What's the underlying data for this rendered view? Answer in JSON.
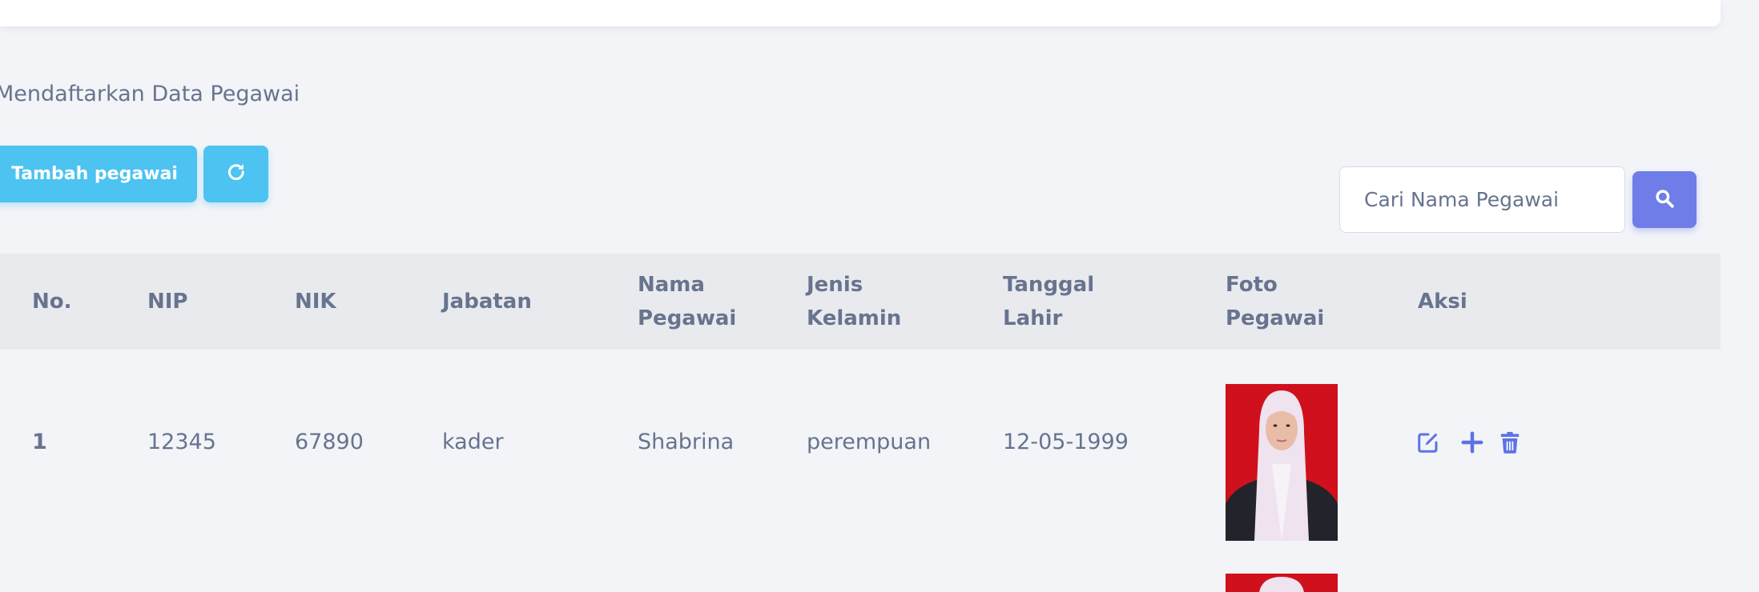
{
  "page": {
    "subtitle": "Mendaftarkan Data Pegawai"
  },
  "toolbar": {
    "add_label": "Tambah pegawai",
    "refresh_icon": "refresh-icon"
  },
  "search": {
    "placeholder": "Cari Nama Pegawai",
    "button_icon": "search-icon"
  },
  "table": {
    "headers": {
      "no": "No.",
      "nip": "NIP",
      "nik": "NIK",
      "jabatan": "Jabatan",
      "nama_1": "Nama",
      "nama_2": "Pegawai",
      "jk_1": "Jenis",
      "jk_2": "Kelamin",
      "tgl_1": "Tanggal",
      "tgl_2": "Lahir",
      "foto_1": "Foto",
      "foto_2": "Pegawai",
      "aksi": "Aksi"
    },
    "rows": [
      {
        "no": "1",
        "nip": "12345",
        "nik": "67890",
        "jabatan": "kader",
        "nama": "Shabrina",
        "jenis_kelamin": "perempuan",
        "tanggal_lahir": "12-05-1999"
      }
    ],
    "action_icons": [
      "edit-icon",
      "plus-icon",
      "trash-icon"
    ]
  },
  "colors": {
    "accent_cyan": "#4cc3f0",
    "accent_indigo": "#6f7de8",
    "text": "#67748e",
    "background": "#f3f4f8",
    "header_bg": "#e9eaee"
  }
}
